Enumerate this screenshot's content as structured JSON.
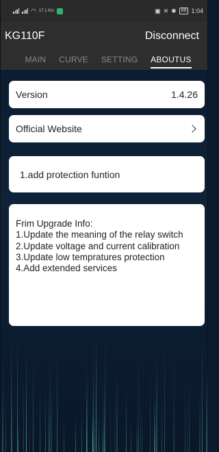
{
  "status_bar": {
    "network_speed": "17.1\nK/s",
    "time": "1:04",
    "battery": "88"
  },
  "header": {
    "title": "KG110F",
    "disconnect_label": "Disconnect"
  },
  "tabs": [
    {
      "label": "MAIN",
      "active": false
    },
    {
      "label": "CURVE",
      "active": false
    },
    {
      "label": "SETTING",
      "active": false
    },
    {
      "label": "ABOUTUS",
      "active": true
    }
  ],
  "about": {
    "version_label": "Version",
    "version_value": "1.4.26",
    "website_label": "Official Website",
    "note": "1.add protection funtion",
    "firmware_info": [
      "Frim Upgrade Info:",
      "1.Update the meaning of the relay switch",
      "2.Update voltage and current calibration",
      "3.Update low tempratures protection",
      "4.Add extended services"
    ]
  },
  "colors": {
    "background": "#0b1a2e",
    "header": "#2e2e2e",
    "tab_inactive": "#8a8a8a",
    "card": "#ffffff"
  }
}
